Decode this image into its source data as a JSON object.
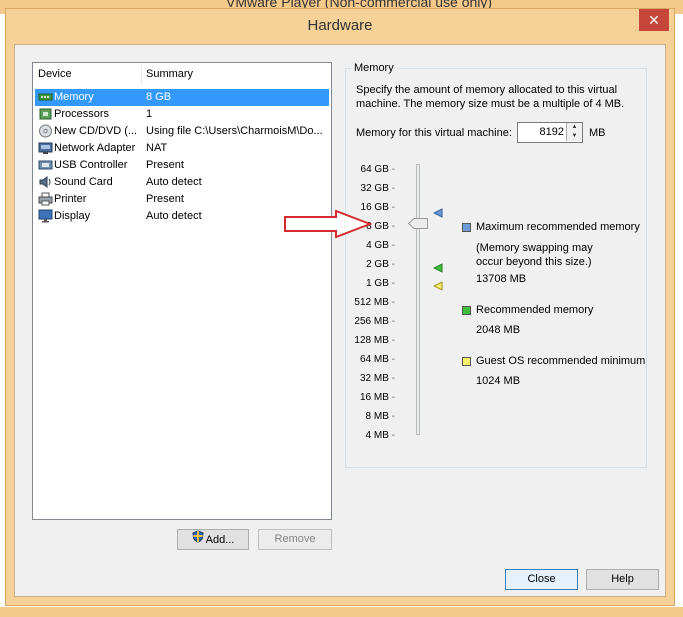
{
  "background_window": {
    "title": "VMware Player (Non-commercial use only)"
  },
  "dialog": {
    "title": "Hardware",
    "close_glyph": "✕"
  },
  "device_list": {
    "headers": {
      "device": "Device",
      "summary": "Summary"
    },
    "items": [
      {
        "name": "Memory",
        "summary": "8 GB",
        "icon": "memory-icon",
        "selected": true
      },
      {
        "name": "Processors",
        "summary": "1",
        "icon": "processor-icon"
      },
      {
        "name": "New CD/DVD (...",
        "summary": "Using file C:\\Users\\CharmoisM\\Do...",
        "icon": "cd-dvd-icon"
      },
      {
        "name": "Network Adapter",
        "summary": "NAT",
        "icon": "network-adapter-icon"
      },
      {
        "name": "USB Controller",
        "summary": "Present",
        "icon": "usb-icon"
      },
      {
        "name": "Sound Card",
        "summary": "Auto detect",
        "icon": "sound-card-icon"
      },
      {
        "name": "Printer",
        "summary": "Present",
        "icon": "printer-icon"
      },
      {
        "name": "Display",
        "summary": "Auto detect",
        "icon": "display-icon"
      }
    ]
  },
  "buttons": {
    "add": "Add...",
    "remove": "Remove",
    "close": "Close",
    "help": "Help"
  },
  "memory": {
    "group_label": "Memory",
    "description": "Specify the amount of memory allocated to this virtual machine. The memory size must be a multiple of 4 MB.",
    "field_label": "Memory for this virtual machine:",
    "value": "8192",
    "unit": "MB",
    "scale": [
      "64 GB",
      "32 GB",
      "16 GB",
      "8 GB",
      "4 GB",
      "2 GB",
      "1 GB",
      "512 MB",
      "256 MB",
      "128 MB",
      "64 MB",
      "32 MB",
      "16 MB",
      "8 MB",
      "4 MB"
    ],
    "legend": {
      "max": {
        "label": "Maximum recommended memory",
        "note": "(Memory swapping may occur beyond this size.)",
        "value": "13708 MB",
        "color": "#6d9ad6"
      },
      "recommended": {
        "label": "Recommended memory",
        "value": "2048 MB",
        "color": "#3fbf3f"
      },
      "guest_min": {
        "label": "Guest OS recommended minimum",
        "value": "1024 MB",
        "color": "#f5f16b"
      }
    }
  },
  "annotation": {
    "arrow_color": "#d92b2b"
  }
}
